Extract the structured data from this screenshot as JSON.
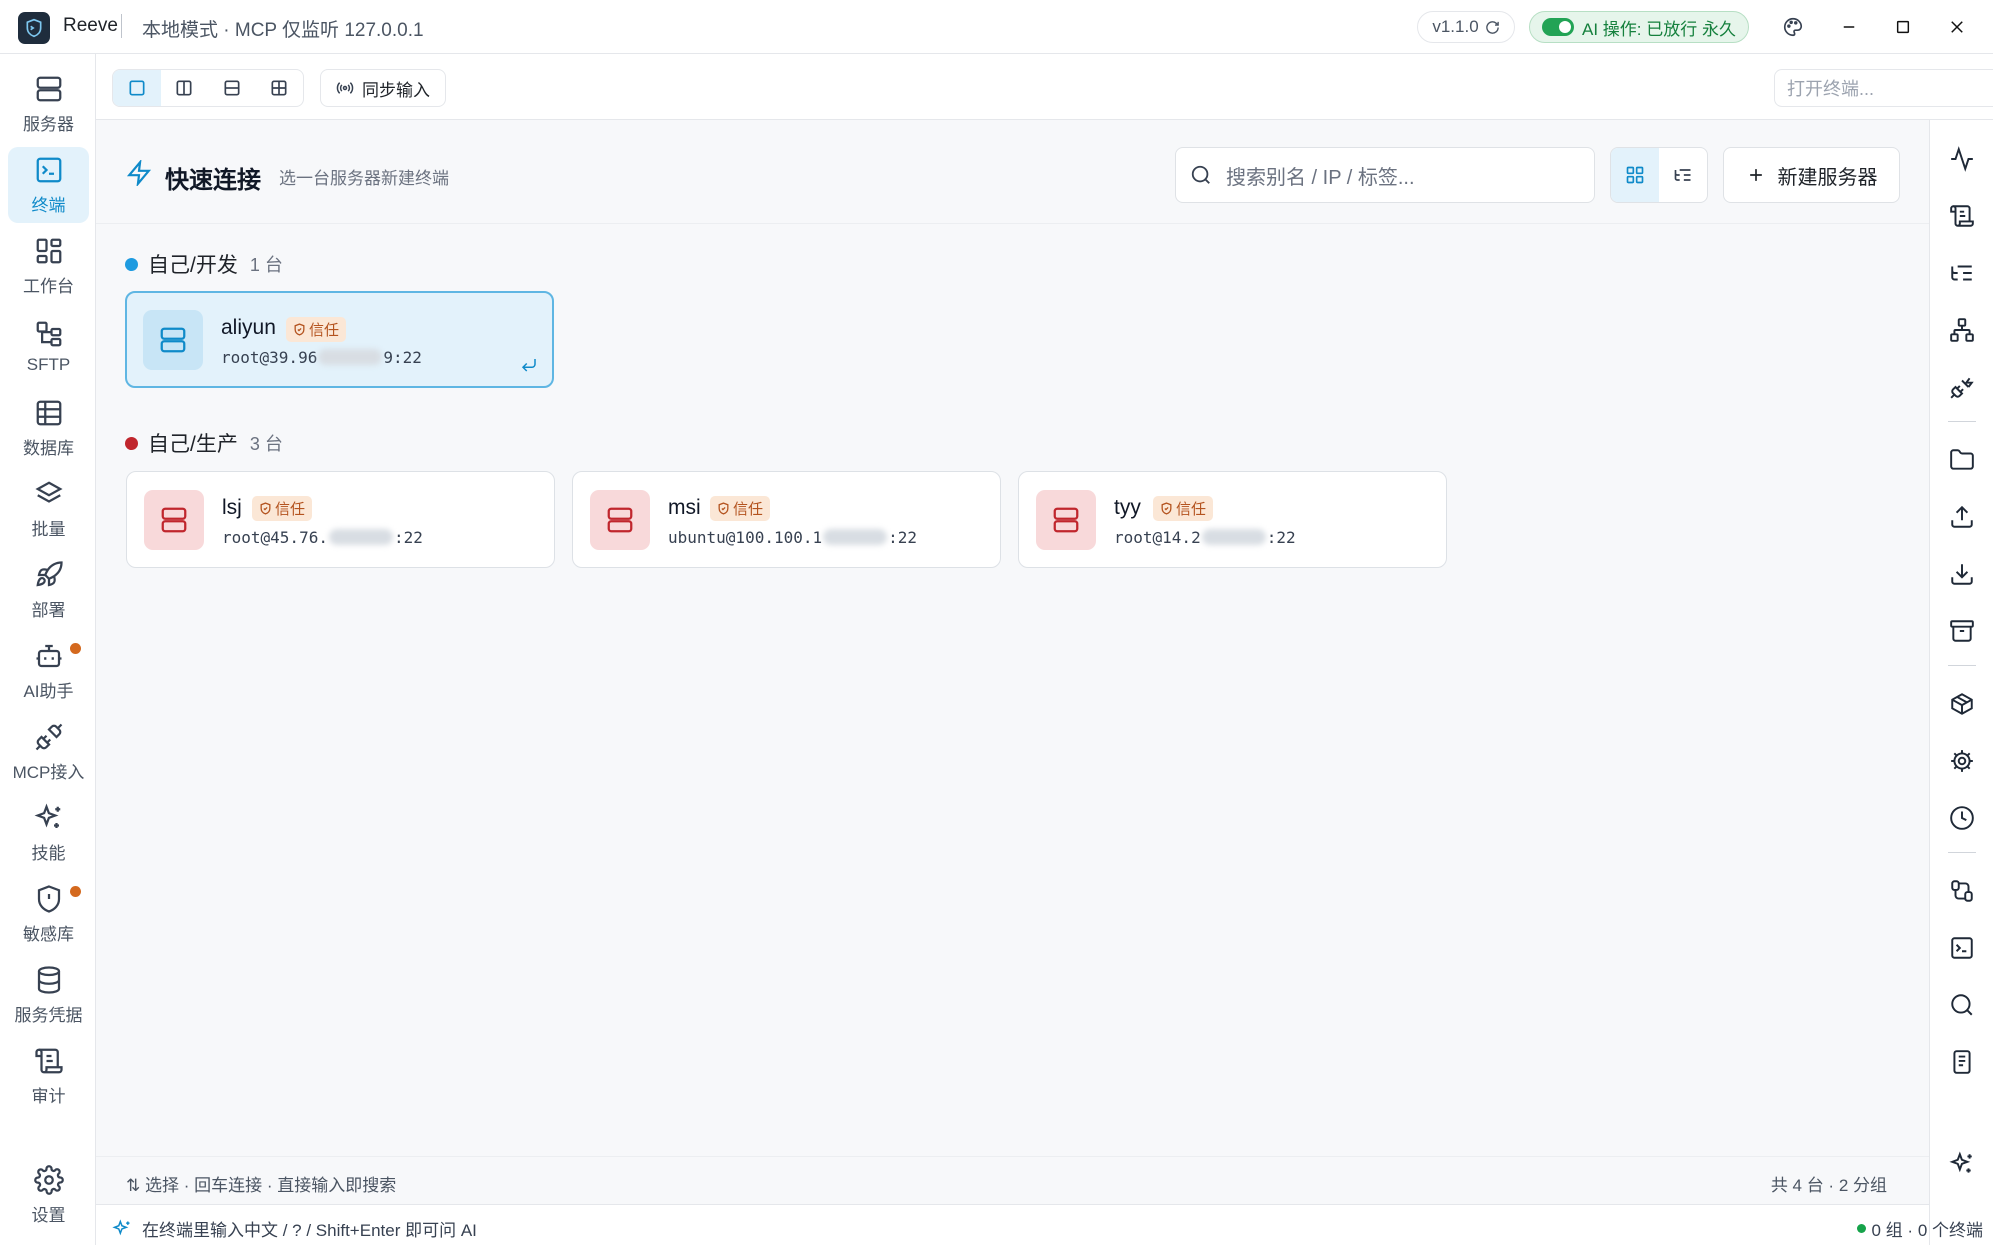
{
  "titlebar": {
    "app_name": "Reeve",
    "mode": "本地模式 · MCP 仅监听 127.0.0.1",
    "version": "v1.1.0",
    "ai_status": "AI 操作: 已放行 永久"
  },
  "sidebar": {
    "items": [
      {
        "label": "服务器",
        "icon": "server-icon"
      },
      {
        "label": "终端",
        "icon": "terminal-icon",
        "active": true
      },
      {
        "label": "工作台",
        "icon": "dashboard-icon"
      },
      {
        "label": "SFTP",
        "icon": "sftp-icon"
      },
      {
        "label": "数据库",
        "icon": "table-icon"
      },
      {
        "label": "批量",
        "icon": "layers-icon"
      },
      {
        "label": "部署",
        "icon": "rocket-icon"
      },
      {
        "label": "AI助手",
        "icon": "bot-icon",
        "badge": true
      },
      {
        "label": "MCP接入",
        "icon": "plug-icon"
      },
      {
        "label": "技能",
        "icon": "sparkles-icon"
      },
      {
        "label": "敏感库",
        "icon": "shield-alert-icon",
        "badge": true
      },
      {
        "label": "服务凭据",
        "icon": "database-icon"
      },
      {
        "label": "审计",
        "icon": "scroll-icon"
      },
      {
        "label": "设置",
        "icon": "gear-icon"
      }
    ]
  },
  "toolbar": {
    "sync_label": "同步输入",
    "terminal_placeholder": "打开终端..."
  },
  "main": {
    "title": "快速连接",
    "subtitle": "选一台服务器新建终端",
    "search_placeholder": "搜索别名 / IP / 标签...",
    "new_server_label": "新建服务器",
    "groups": [
      {
        "name": "自己/开发",
        "count": "1 台",
        "color": "#1e9be0",
        "servers": [
          {
            "name": "aliyun",
            "badge": "信任",
            "addr_prefix": "root@39.96",
            "addr_suffix": "9:22"
          }
        ]
      },
      {
        "name": "自己/生产",
        "count": "3 台",
        "color": "#c0262d",
        "servers": [
          {
            "name": "lsj",
            "badge": "信任",
            "addr_prefix": "root@45.76.",
            "addr_suffix": ":22"
          },
          {
            "name": "msi",
            "badge": "信任",
            "addr_prefix": "ubuntu@100.100.1",
            "addr_suffix": ":22"
          },
          {
            "name": "tyy",
            "badge": "信任",
            "addr_prefix": "root@14.2",
            "addr_suffix": ":22"
          }
        ]
      }
    ],
    "footer_hint": "选择 · 回车连接 · 直接输入即搜索",
    "footer_count": "共 4 台 · 2 分组"
  },
  "statusbar": {
    "hint": "在终端里输入中文 / ? / Shift+Enter 即可问 AI",
    "summary": "0 组 · 0 个终端"
  },
  "colors": {
    "accent": "#0f8ac9",
    "dev_group": "#1e9be0",
    "prod_group": "#c0262d",
    "trust_badge": "#b4531f"
  }
}
